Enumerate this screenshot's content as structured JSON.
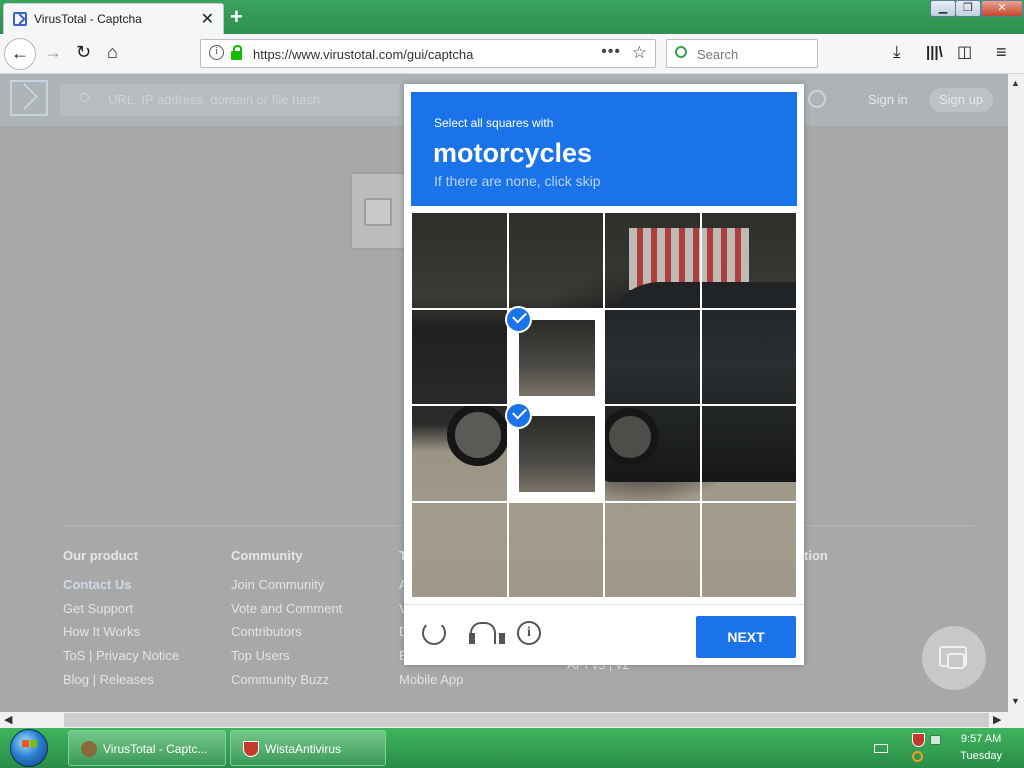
{
  "browser": {
    "tab_title": "VirusTotal - Captcha",
    "url": "https://www.virustotal.com/gui/captcha",
    "search_placeholder": "Search",
    "window_buttons": {
      "minimize": "▁",
      "maximize": "❐",
      "close": "✕"
    }
  },
  "vt": {
    "search_placeholder": "URL, IP address, domain or file hash",
    "signin": "Sign in",
    "signup": "Sign up"
  },
  "captcha": {
    "instruction": "Select all squares with",
    "target": "motorcycles",
    "hint": "If there are none, click skip",
    "next": "NEXT",
    "selected_tiles": [
      5,
      9
    ]
  },
  "footer": {
    "col1": {
      "heading": "Our product",
      "links": [
        "Contact Us",
        "Get Support",
        "How It Works",
        "ToS | Privacy Notice",
        "Blog | Releases"
      ]
    },
    "col2": {
      "heading": "Community",
      "links": [
        "Join Community",
        "Vote and Comment",
        "Contributors",
        "Top Users",
        "Community Buzz"
      ]
    },
    "col3": {
      "heading": "T",
      "links": [
        "A",
        "V",
        "D",
        "E",
        "Mobile App"
      ]
    },
    "col4": {
      "heading": "",
      "links": [
        "",
        "",
        "",
        "",
        "API v3 | v2"
      ]
    },
    "col5": {
      "heading": "tion"
    }
  },
  "taskbar": {
    "tasks": [
      "VirusTotal - Captc...",
      "WistaAntivirus"
    ],
    "time": "9:57 AM",
    "day": "Tuesday"
  }
}
